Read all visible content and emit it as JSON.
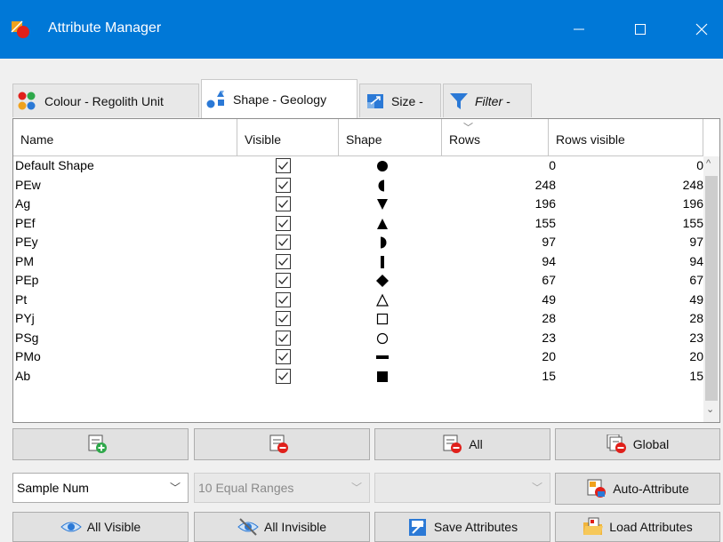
{
  "window": {
    "title": "Attribute Manager",
    "minimize": "—",
    "maximize": "☐",
    "close": "✕"
  },
  "tabs": [
    {
      "label": "Colour - Regolith Unit",
      "icon": "colour-dots-icon"
    },
    {
      "label": "Shape - Geology",
      "icon": "shapes-icon",
      "active": true
    },
    {
      "label": "Size -",
      "icon": "size-icon"
    },
    {
      "label": "Filter -",
      "icon": "filter-funnel-icon"
    }
  ],
  "grid": {
    "columns": [
      "Name",
      "Visible",
      "Shape",
      "Rows",
      "Rows visible"
    ],
    "sort_indicator": "﹀",
    "rows": [
      {
        "name": "Default Shape",
        "visible": true,
        "shape": "circle",
        "rows": "0",
        "rows_visible": "0"
      },
      {
        "name": "PEw",
        "visible": true,
        "shape": "half-circle-left",
        "rows": "248",
        "rows_visible": "248"
      },
      {
        "name": "Ag",
        "visible": true,
        "shape": "triangle-down",
        "rows": "196",
        "rows_visible": "196"
      },
      {
        "name": "PEf",
        "visible": true,
        "shape": "triangle-up",
        "rows": "155",
        "rows_visible": "155"
      },
      {
        "name": "PEy",
        "visible": true,
        "shape": "half-circle-right",
        "rows": "97",
        "rows_visible": "97"
      },
      {
        "name": "PM",
        "visible": true,
        "shape": "vertical-bar",
        "rows": "94",
        "rows_visible": "94"
      },
      {
        "name": "PEp",
        "visible": true,
        "shape": "diamond",
        "rows": "67",
        "rows_visible": "67"
      },
      {
        "name": "Pt",
        "visible": true,
        "shape": "triangle-up-open",
        "rows": "49",
        "rows_visible": "49"
      },
      {
        "name": "PYj",
        "visible": true,
        "shape": "square-open",
        "rows": "28",
        "rows_visible": "28"
      },
      {
        "name": "PSg",
        "visible": true,
        "shape": "circle-open",
        "rows": "23",
        "rows_visible": "23"
      },
      {
        "name": "PMo",
        "visible": true,
        "shape": "horizontal-bar",
        "rows": "20",
        "rows_visible": "20"
      },
      {
        "name": "Ab",
        "visible": true,
        "shape": "square",
        "rows": "15",
        "rows_visible": "15"
      }
    ]
  },
  "scroll": {
    "up": "^",
    "down": "⌄"
  },
  "buttons": {
    "add": {
      "label": "",
      "icon": "add-attribute-icon"
    },
    "remove": {
      "label": "",
      "icon": "remove-attribute-icon"
    },
    "remove_all": {
      "label": "All",
      "icon": "remove-all-icon"
    },
    "global": {
      "label": "Global",
      "icon": "global-remove-icon"
    },
    "auto_attribute": {
      "label": "Auto-Attribute",
      "icon": "auto-attribute-icon"
    },
    "all_visible": {
      "label": "All Visible",
      "icon": "eye-icon"
    },
    "all_invisible": {
      "label": "All Invisible",
      "icon": "eye-slash-icon"
    },
    "save_attributes": {
      "label": "Save Attributes",
      "icon": "save-attributes-icon"
    },
    "load_attributes": {
      "label": "Load Attributes",
      "icon": "folder-open-icon"
    }
  },
  "selects": {
    "field": {
      "value": "Sample Num"
    },
    "method": {
      "value": "10 Equal Ranges",
      "disabled": true
    },
    "third": {
      "value": "",
      "disabled": true
    }
  },
  "colors": {
    "titlebar": "#0078d7",
    "accent_red": "#e0201b",
    "accent_blue": "#2b79d6",
    "accent_green": "#2ea84a"
  }
}
